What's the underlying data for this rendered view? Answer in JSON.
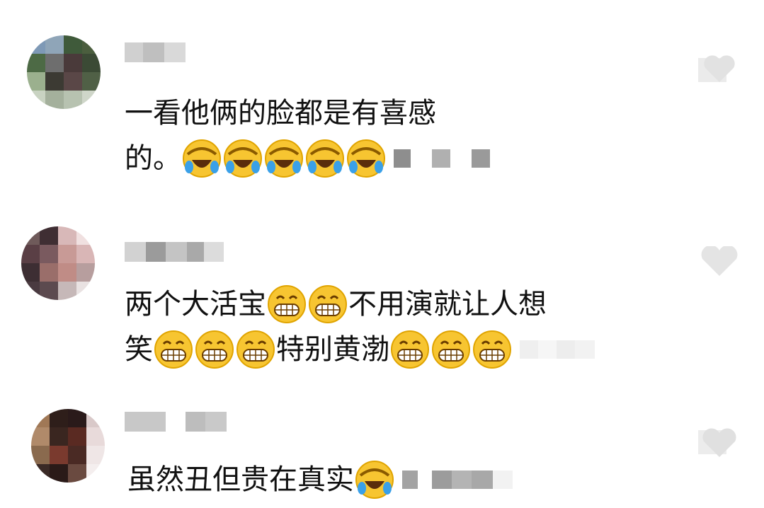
{
  "comments": [
    {
      "line1": "一看他俩的脸都是有喜感",
      "line2_text": "的。",
      "line2_emoji": [
        "laughing-tears",
        "laughing-tears",
        "laughing-tears",
        "laughing-tears",
        "laughing-tears"
      ]
    },
    {
      "line1_a": "两个大活宝",
      "line1_emoji": [
        "grin",
        "grin"
      ],
      "line1_b": "不用演就让人想",
      "line2_a": "笑",
      "line2_emoji_a": [
        "grin",
        "grin",
        "grin"
      ],
      "line2_b": "特别黄渤",
      "line2_emoji_b": [
        "grin",
        "grin",
        "grin"
      ]
    },
    {
      "line1": "虽然丑但贵在真实",
      "line1_emoji": [
        "laughing-tears"
      ]
    }
  ],
  "colors": {
    "emoji_face": "#f7c531",
    "tear": "#3aa0e8",
    "blur_gray": "#c9c9c9",
    "like_gray": "#e4e4e4"
  }
}
